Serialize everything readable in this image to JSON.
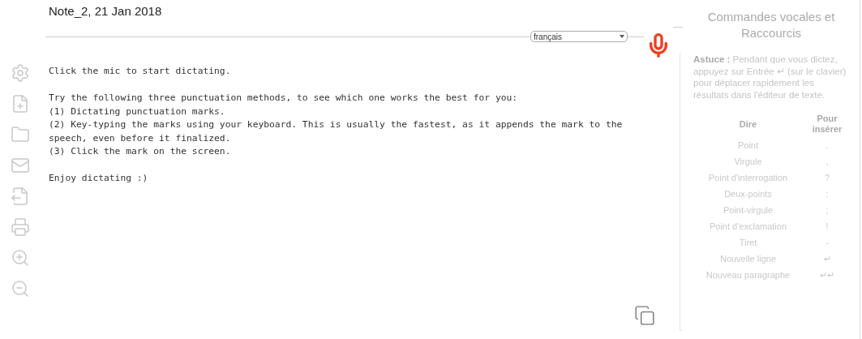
{
  "note": {
    "title": "Note_2, 21 Jan 2018"
  },
  "language_select": {
    "value": "français"
  },
  "editor": {
    "paragraphs": [
      [
        "Click the mic to start dictating."
      ],
      [
        "Try the following three punctuation methods, to see which one works the best for you:",
        "(1) Dictating punctuation marks.",
        "(2) Key-typing the marks using your keyboard. This is usually the fastest, as it appends the mark to the",
        "speech, even before it finalized.",
        "(3) Click the mark on the screen."
      ],
      [
        "Enjoy dictating :)"
      ]
    ]
  },
  "panel": {
    "title": "Commandes vocales et Raccourcis",
    "tip": "**Astuce :** Pendant que vous dictez, appuyez sur Entrée ↵ (sur le clavier) pour déplacer rapidement les résultats dans l'éditeur de texte.",
    "columns": [
      "Dire",
      "Pour insérer"
    ],
    "rows": [
      {
        "say": "Point",
        "insert": "."
      },
      {
        "say": "Virgule",
        "insert": ","
      },
      {
        "say": "Point d'interrogation",
        "insert": "?"
      },
      {
        "say": "Deux-points",
        "insert": ":"
      },
      {
        "say": "Point-virgule",
        "insert": ";"
      },
      {
        "say": "Point d'exclamation",
        "insert": "!"
      },
      {
        "say": "Tiret",
        "insert": "-"
      },
      {
        "say": "Nouvelle ligne",
        "insert": "↵"
      },
      {
        "say": "Nouveau paragraphe",
        "insert": "↵↵"
      }
    ]
  }
}
